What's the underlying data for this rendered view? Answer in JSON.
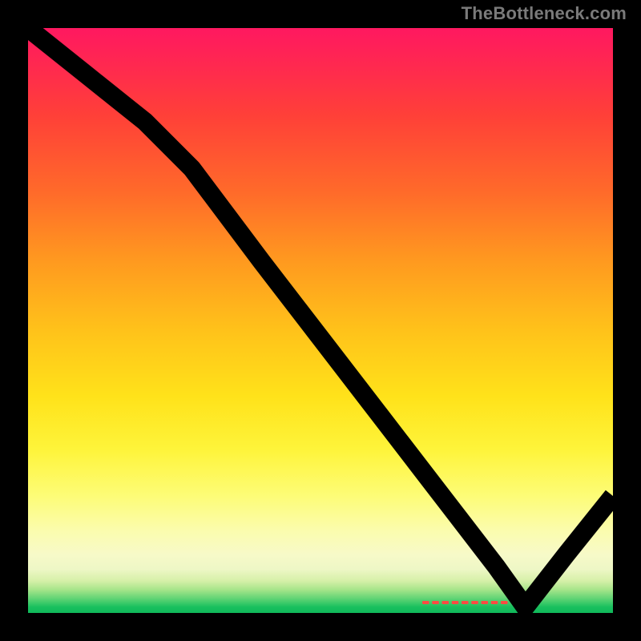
{
  "watermark": "TheBottleneck.com",
  "colors": {
    "frame": "#000000",
    "curve": "#000000",
    "dash": "#ff4a42",
    "watermark": "#7a7a7a",
    "gradient_stops": [
      "#ff1860",
      "#ff2a4e",
      "#ff4038",
      "#ff6a2a",
      "#ff9a1f",
      "#ffc31a",
      "#ffe21a",
      "#fef43a",
      "#fdfc77",
      "#fbfcae",
      "#f7fac8",
      "#eef7c6",
      "#d6f0a8",
      "#a7e58a",
      "#62d475",
      "#18c05e",
      "#11b85a"
    ]
  },
  "chart_data": {
    "type": "line",
    "title": "",
    "xlabel": "",
    "ylabel": "",
    "xlim": [
      0,
      100
    ],
    "ylim": [
      0,
      100
    ],
    "grid": false,
    "legend": false,
    "series": [
      {
        "name": "bottleneck-curve",
        "x": [
          0,
          10,
          20,
          28,
          40,
          50,
          60,
          70,
          80,
          85,
          92,
          100
        ],
        "y": [
          100,
          92,
          84,
          76,
          60,
          47,
          34,
          21,
          8,
          1,
          10,
          20
        ]
      }
    ],
    "annotations": [
      {
        "name": "trough-marker-dashes",
        "x": 75,
        "y": 1
      }
    ]
  }
}
